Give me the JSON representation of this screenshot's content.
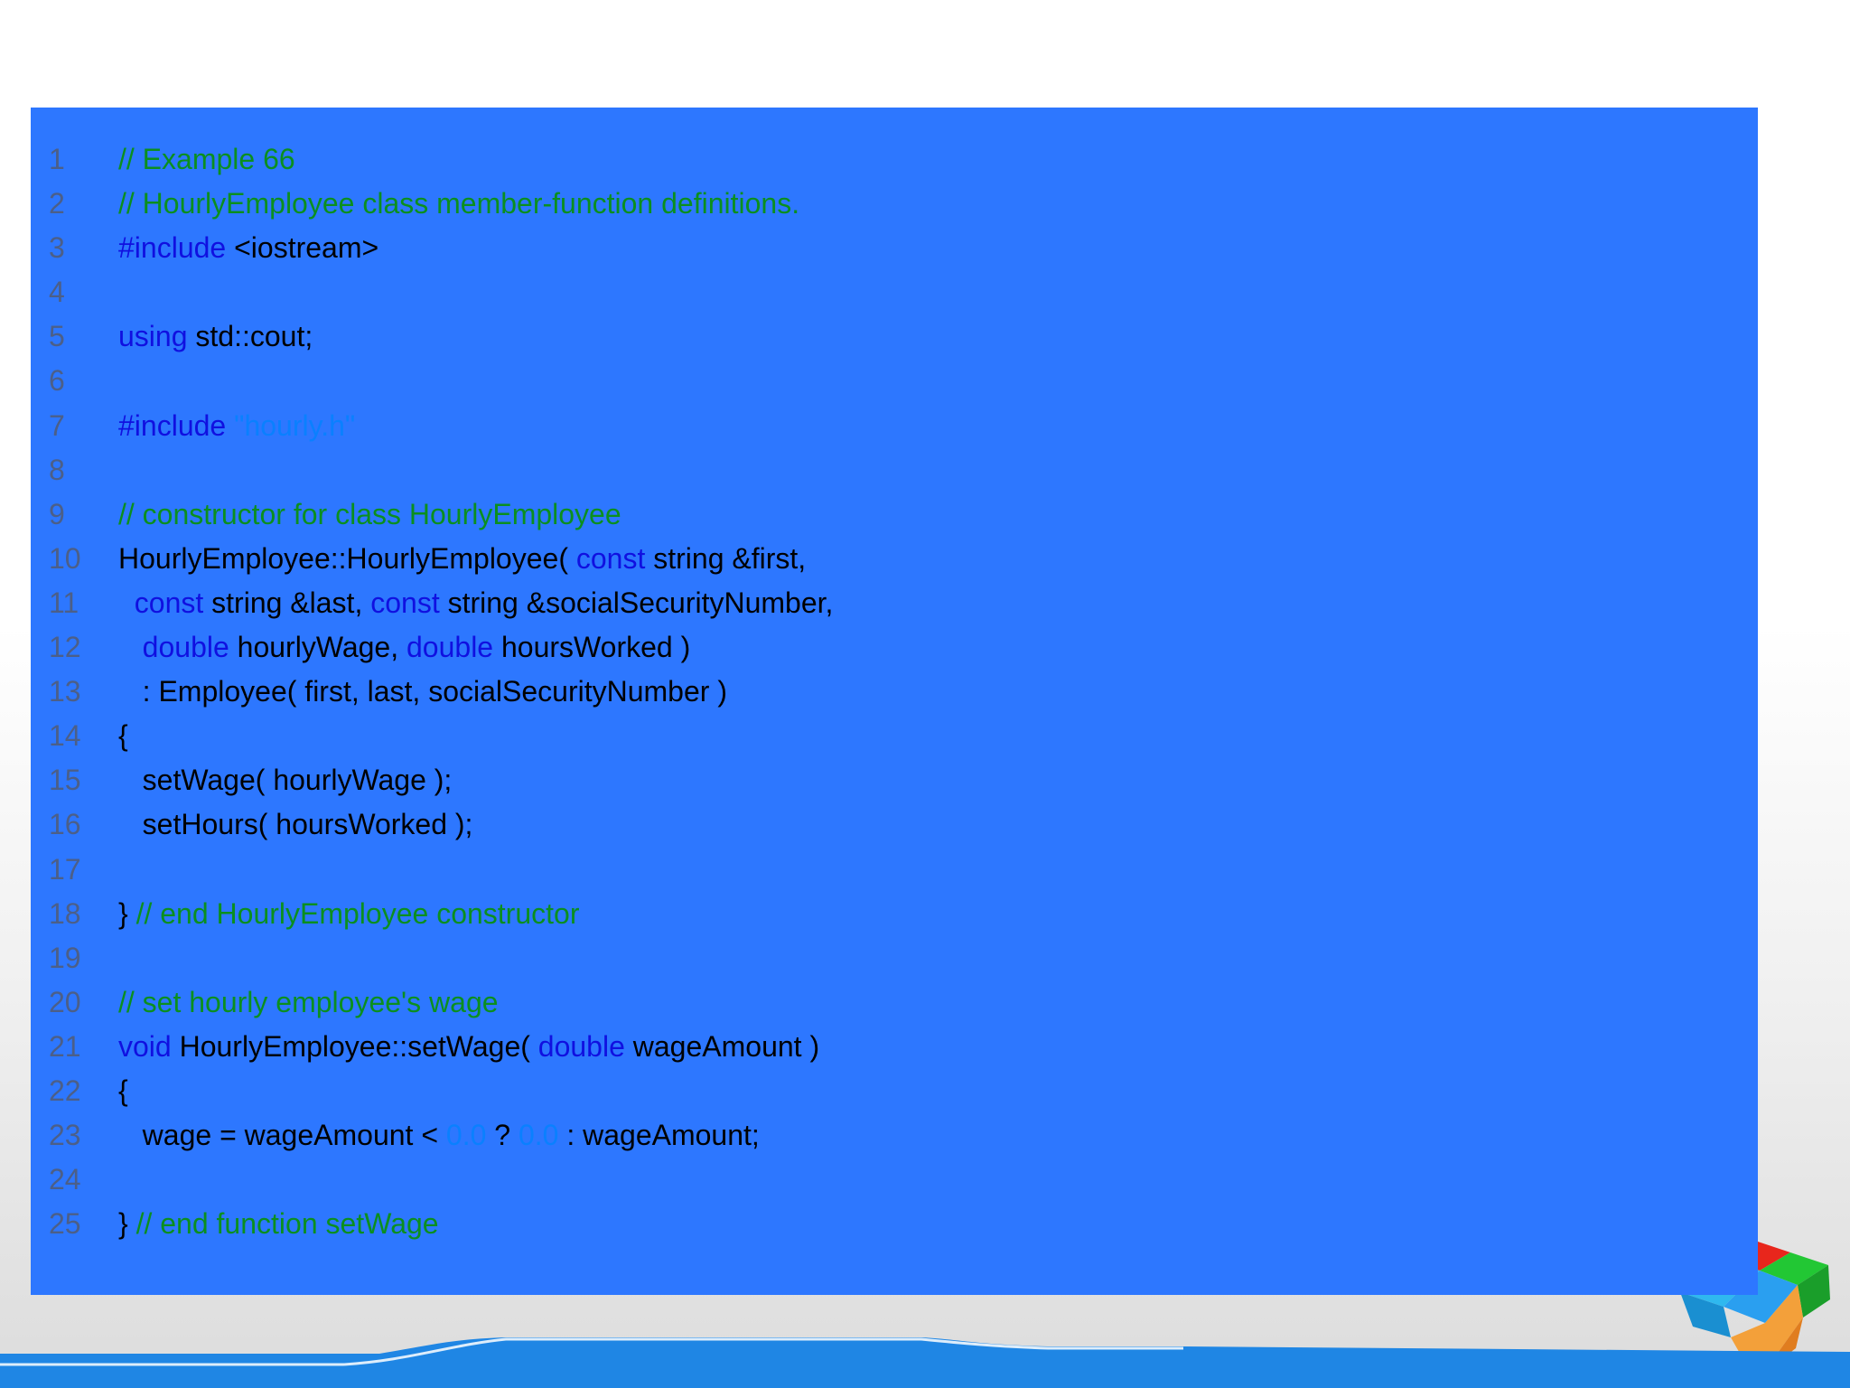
{
  "colors": {
    "panel_background": "#2d77ff",
    "line_number": "#4c5f88",
    "comment": "#0b8f1f",
    "keyword": "#1010e0",
    "string": "#0a80ff",
    "code": "#000000"
  },
  "decorations": {
    "corner_graphic": "cube-graphic",
    "bottom_band": "wave-band"
  },
  "code_lines": [
    {
      "n": "1",
      "tokens": [
        {
          "t": "// Example 66",
          "k": "comment"
        }
      ]
    },
    {
      "n": "2",
      "tokens": [
        {
          "t": "// HourlyEmployee class member-function definitions.",
          "k": "comment"
        }
      ]
    },
    {
      "n": "3",
      "tokens": [
        {
          "t": "#include ",
          "k": "keyword"
        },
        {
          "t": "<iostream>",
          "k": "normal"
        }
      ]
    },
    {
      "n": "4",
      "tokens": []
    },
    {
      "n": "5",
      "tokens": [
        {
          "t": "using",
          "k": "keyword"
        },
        {
          "t": " std::cout;",
          "k": "normal"
        }
      ]
    },
    {
      "n": "6",
      "tokens": []
    },
    {
      "n": "7",
      "tokens": [
        {
          "t": "#include ",
          "k": "keyword"
        },
        {
          "t": "\"hourly.h\"",
          "k": "string"
        }
      ]
    },
    {
      "n": "8",
      "tokens": []
    },
    {
      "n": "9",
      "tokens": [
        {
          "t": "// constructor for class HourlyEmployee",
          "k": "comment"
        }
      ]
    },
    {
      "n": "10",
      "tokens": [
        {
          "t": "HourlyEmployee::HourlyEmployee( ",
          "k": "normal"
        },
        {
          "t": "const",
          "k": "keyword"
        },
        {
          "t": " string &first,",
          "k": "normal"
        }
      ]
    },
    {
      "n": "11",
      "tokens": [
        {
          "t": "  ",
          "k": "normal"
        },
        {
          "t": "const",
          "k": "keyword"
        },
        {
          "t": " string &last, ",
          "k": "normal"
        },
        {
          "t": "const",
          "k": "keyword"
        },
        {
          "t": " string &socialSecurityNumber,",
          "k": "normal"
        }
      ]
    },
    {
      "n": "12",
      "tokens": [
        {
          "t": "   ",
          "k": "normal"
        },
        {
          "t": "double",
          "k": "keyword"
        },
        {
          "t": " hourlyWage, ",
          "k": "normal"
        },
        {
          "t": "double",
          "k": "keyword"
        },
        {
          "t": " hoursWorked )",
          "k": "normal"
        }
      ]
    },
    {
      "n": "13",
      "tokens": [
        {
          "t": "   : Employee( first, last, socialSecurityNumber )",
          "k": "normal"
        }
      ]
    },
    {
      "n": "14",
      "tokens": [
        {
          "t": "{",
          "k": "normal"
        }
      ]
    },
    {
      "n": "15",
      "tokens": [
        {
          "t": "   setWage( hourlyWage );",
          "k": "normal"
        }
      ]
    },
    {
      "n": "16",
      "tokens": [
        {
          "t": "   setHours( hoursWorked );",
          "k": "normal"
        }
      ]
    },
    {
      "n": "17",
      "tokens": []
    },
    {
      "n": "18",
      "tokens": [
        {
          "t": "} ",
          "k": "normal"
        },
        {
          "t": "// end HourlyEmployee constructor",
          "k": "comment"
        }
      ]
    },
    {
      "n": "19",
      "tokens": []
    },
    {
      "n": "20",
      "tokens": [
        {
          "t": "// set hourly employee's wage",
          "k": "comment"
        }
      ]
    },
    {
      "n": "21",
      "tokens": [
        {
          "t": "void",
          "k": "keyword"
        },
        {
          "t": " HourlyEmployee::setWage( ",
          "k": "normal"
        },
        {
          "t": "double",
          "k": "keyword"
        },
        {
          "t": " wageAmount )",
          "k": "normal"
        }
      ]
    },
    {
      "n": "22",
      "tokens": [
        {
          "t": "{",
          "k": "normal"
        }
      ]
    },
    {
      "n": "23",
      "tokens": [
        {
          "t": "   wage = wageAmount < ",
          "k": "normal"
        },
        {
          "t": "0.0",
          "k": "number"
        },
        {
          "t": " ? ",
          "k": "normal"
        },
        {
          "t": "0.0",
          "k": "number"
        },
        {
          "t": " : wageAmount;",
          "k": "normal"
        }
      ]
    },
    {
      "n": "24",
      "tokens": []
    },
    {
      "n": "25",
      "tokens": [
        {
          "t": "} ",
          "k": "normal"
        },
        {
          "t": "// end function setWage",
          "k": "comment"
        }
      ]
    }
  ]
}
